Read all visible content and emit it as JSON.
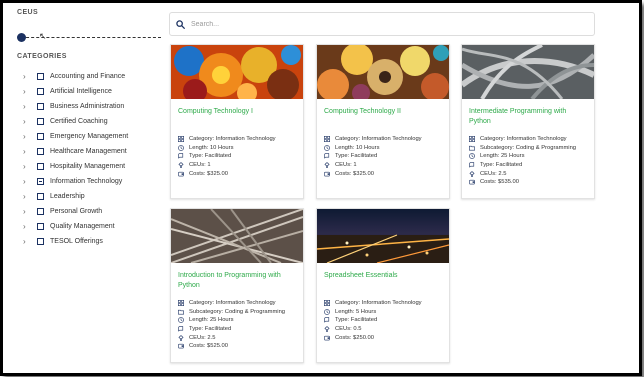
{
  "sidebar": {
    "ceus_title": "CEUS",
    "categories_title": "CATEGORIES",
    "categories": [
      {
        "label": "Accounting and Finance",
        "checked": false
      },
      {
        "label": "Artificial Intelligence",
        "checked": false
      },
      {
        "label": "Business Administration",
        "checked": false
      },
      {
        "label": "Certified Coaching",
        "checked": false
      },
      {
        "label": "Emergency Management",
        "checked": false
      },
      {
        "label": "Healthcare Management",
        "checked": false
      },
      {
        "label": "Hospitality Management",
        "checked": false
      },
      {
        "label": "Information Technology",
        "checked": true
      },
      {
        "label": "Leadership",
        "checked": false
      },
      {
        "label": "Personal Growth",
        "checked": false
      },
      {
        "label": "Quality Management",
        "checked": false
      },
      {
        "label": "TESOL Offerings",
        "checked": false
      }
    ]
  },
  "search": {
    "placeholder": "Search...",
    "value": ""
  },
  "colors": {
    "title_green": "#2eaa4a",
    "navy": "#1b3161"
  },
  "cards": [
    {
      "title": "Computing Technology I",
      "image": "orange-glass-art",
      "rows": [
        {
          "icon": "category-icon",
          "text": "Category: Information Technology"
        },
        {
          "icon": "clock-icon",
          "text": "Length: 10 Hours"
        },
        {
          "icon": "type-icon",
          "text": "Type: Facilitated"
        },
        {
          "icon": "ceu-icon",
          "text": "CEUs: 1"
        },
        {
          "icon": "cost-icon",
          "text": "Costs: $325.00"
        }
      ]
    },
    {
      "title": "Computing Technology II",
      "image": "glass-shells-art",
      "rows": [
        {
          "icon": "category-icon",
          "text": "Category: Information Technology"
        },
        {
          "icon": "clock-icon",
          "text": "Length: 10 Hours"
        },
        {
          "icon": "type-icon",
          "text": "Type: Facilitated"
        },
        {
          "icon": "ceu-icon",
          "text": "CEUs: 1"
        },
        {
          "icon": "cost-icon",
          "text": "Costs: $325.00"
        }
      ]
    },
    {
      "title": "Intermediate Programming with Python",
      "image": "highway-interchange",
      "rows": [
        {
          "icon": "category-icon",
          "text": "Category: Information Technology"
        },
        {
          "icon": "folder-icon",
          "text": "Subcategory: Coding & Programming"
        },
        {
          "icon": "clock-icon",
          "text": "Length: 25 Hours"
        },
        {
          "icon": "type-icon",
          "text": "Type: Facilitated"
        },
        {
          "icon": "ceu-icon",
          "text": "CEUs: 2.5"
        },
        {
          "icon": "cost-icon",
          "text": "Costs: $535.00"
        }
      ]
    },
    {
      "title": "Introduction to Programming with Python",
      "image": "railway-tracks",
      "rows": [
        {
          "icon": "category-icon",
          "text": "Category: Information Technology"
        },
        {
          "icon": "folder-icon",
          "text": "Subcategory: Coding & Programming"
        },
        {
          "icon": "clock-icon",
          "text": "Length: 25 Hours"
        },
        {
          "icon": "type-icon",
          "text": "Type: Facilitated"
        },
        {
          "icon": "ceu-icon",
          "text": "CEUs: 2.5"
        },
        {
          "icon": "cost-icon",
          "text": "Costs: $525.00"
        }
      ]
    },
    {
      "title": "Spreadsheet Essentials",
      "image": "city-night-lights",
      "rows": [
        {
          "icon": "category-icon",
          "text": "Category: Information Technology"
        },
        {
          "icon": "clock-icon",
          "text": "Length: 5 Hours"
        },
        {
          "icon": "type-icon",
          "text": "Type: Facilitated"
        },
        {
          "icon": "ceu-icon",
          "text": "CEUs: 0.5"
        },
        {
          "icon": "cost-icon",
          "text": "Costs: $250.00"
        }
      ]
    }
  ]
}
